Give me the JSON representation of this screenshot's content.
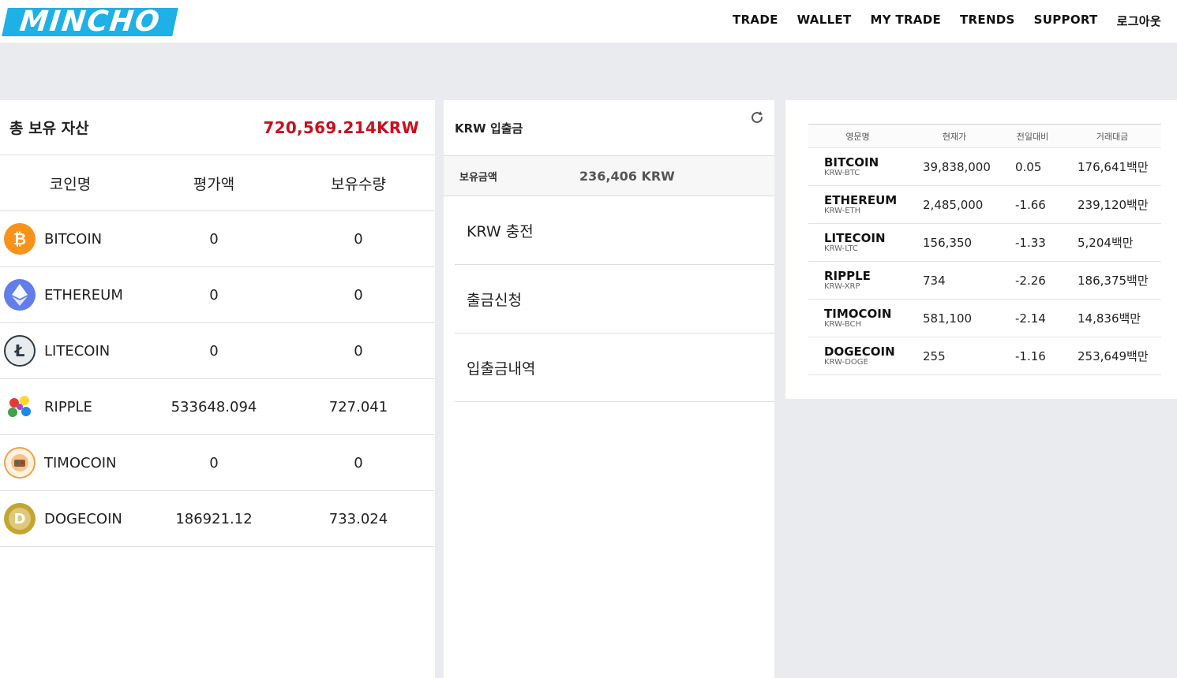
{
  "header": {
    "logo_text": "MINCHO",
    "nav": [
      "TRADE",
      "WALLET",
      "MY TRADE",
      "TRENDS",
      "SUPPORT",
      "로그아웃"
    ]
  },
  "assets": {
    "title": "총 보유 자산",
    "total": "720,569.214KRW",
    "columns": [
      "코인명",
      "평가액",
      "보유수량"
    ],
    "rows": [
      {
        "name": "BITCOIN",
        "icon": "bitcoin-icon",
        "eval": "0",
        "qty": "0"
      },
      {
        "name": "ETHEREUM",
        "icon": "ethereum-icon",
        "eval": "0",
        "qty": "0"
      },
      {
        "name": "LITECOIN",
        "icon": "litecoin-icon",
        "eval": "0",
        "qty": "0"
      },
      {
        "name": "RIPPLE",
        "icon": "ripple-icon",
        "eval": "533648.094",
        "qty": "727.041"
      },
      {
        "name": "TIMOCOIN",
        "icon": "timocoin-icon",
        "eval": "0",
        "qty": "0"
      },
      {
        "name": "DOGECOIN",
        "icon": "dogecoin-icon",
        "eval": "186921.12",
        "qty": "733.024"
      }
    ]
  },
  "krw": {
    "title": "KRW 입출금",
    "balance_label": "보유금액",
    "balance_value": "236,406 KRW",
    "menu": [
      "KRW 충전",
      "출금신청",
      "입출금내역"
    ]
  },
  "market": {
    "columns": [
      "영문명",
      "현재가",
      "전일대비",
      "거래대금"
    ],
    "rows": [
      {
        "name": "BITCOIN",
        "pair": "KRW-BTC",
        "price": "39,838,000",
        "change": "0.05",
        "volume": "176,641백만"
      },
      {
        "name": "ETHEREUM",
        "pair": "KRW-ETH",
        "price": "2,485,000",
        "change": "-1.66",
        "volume": "239,120백만"
      },
      {
        "name": "LITECOIN",
        "pair": "KRW-LTC",
        "price": "156,350",
        "change": "-1.33",
        "volume": "5,204백만"
      },
      {
        "name": "RIPPLE",
        "pair": "KRW-XRP",
        "price": "734",
        "change": "-2.26",
        "volume": "186,375백만"
      },
      {
        "name": "TIMOCOIN",
        "pair": "KRW-BCH",
        "price": "581,100",
        "change": "-2.14",
        "volume": "14,836백만"
      },
      {
        "name": "DOGECOIN",
        "pair": "KRW-DOGE",
        "price": "255",
        "change": "-1.16",
        "volume": "253,649백만"
      }
    ]
  },
  "colors": {
    "logo": "#1fb0e6",
    "total_red": "#c8101c",
    "page_bg": "#e9ebef"
  }
}
